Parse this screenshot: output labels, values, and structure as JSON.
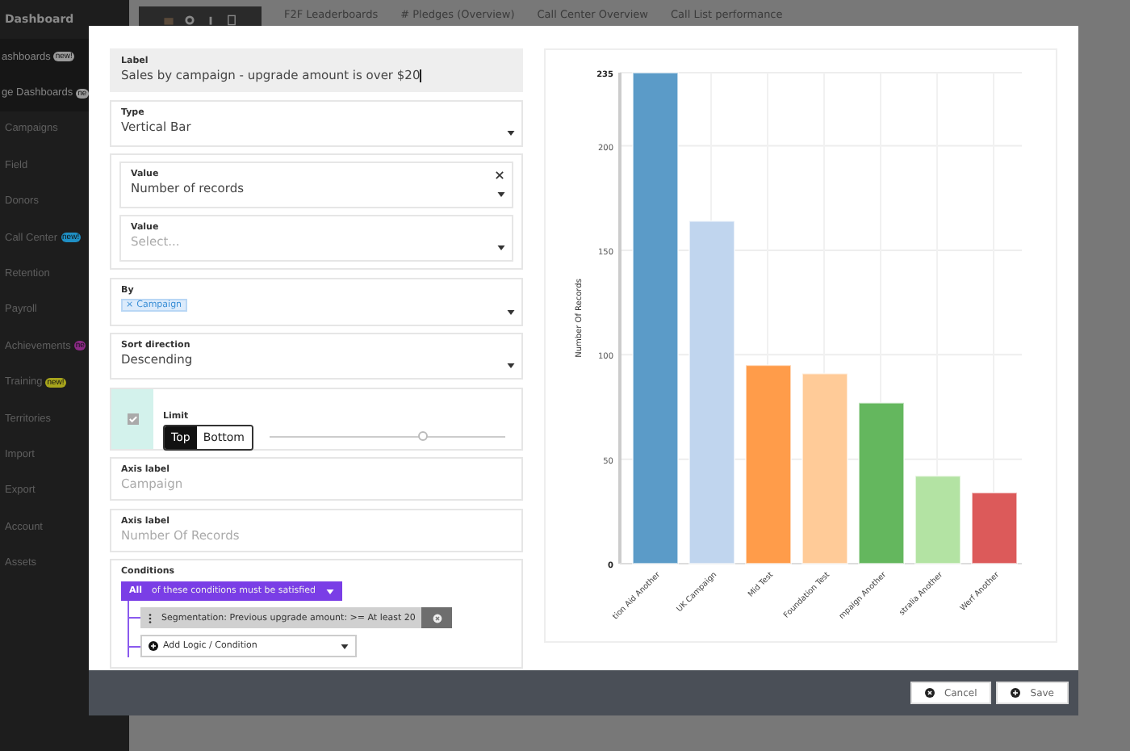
{
  "sidebar": {
    "header": "Dashboard",
    "items": [
      {
        "label": "ashboards",
        "badge": "new!",
        "color": "#9a9a9a",
        "group": true
      },
      {
        "label": "ge Dashboards",
        "badge": "ne",
        "color": "#9a9a9a",
        "group": true
      },
      {
        "label": "Campaigns",
        "group": false
      },
      {
        "label": "Field",
        "group": false
      },
      {
        "label": "Donors",
        "group": false
      },
      {
        "label": "Call Center",
        "badge": "new!",
        "color": "#1f8fc4",
        "group": false
      },
      {
        "label": "Retention",
        "group": false
      },
      {
        "label": "Payroll",
        "group": false
      },
      {
        "label": "Achievements",
        "badge": "ne",
        "color": "#8b2a86",
        "group": false
      },
      {
        "label": "Training",
        "badge": "new!",
        "color": "#a8a51c",
        "group": false
      },
      {
        "label": "Territories",
        "group": false
      },
      {
        "label": "Import",
        "group": false
      },
      {
        "label": "Export",
        "group": false
      },
      {
        "label": "Account",
        "group": false
      },
      {
        "label": "Assets",
        "group": false
      }
    ]
  },
  "tabs": [
    "F2F Leaderboards",
    "# Pledges (Overview)",
    "Call Center Overview",
    "Call List performance"
  ],
  "form": [
    {
      "kind": "input",
      "label": "Label",
      "value": "Sales by campaign - upgrade amount is over $20",
      "focused": true
    },
    {
      "kind": "select",
      "label": "Type",
      "value": "Vertical Bar"
    },
    {
      "kind": "group",
      "items": [
        {
          "label": "Value",
          "value": "Number of records",
          "removable": true
        },
        {
          "label": "Value",
          "placeholder": "Select...",
          "removable": false
        }
      ]
    },
    {
      "kind": "tags",
      "label": "By",
      "tags": [
        {
          "remove": "×",
          "label": "Campaign"
        }
      ]
    },
    {
      "kind": "select",
      "label": "Sort direction",
      "value": "Descending"
    },
    {
      "kind": "limit",
      "label": "Limit",
      "checked": true,
      "options": [
        {
          "label": "Top",
          "selected": true
        },
        {
          "label": "Bottom",
          "selected": false
        }
      ],
      "level": 0.65
    },
    {
      "kind": "input",
      "label": "Axis label",
      "placeholder": "Campaign",
      "focused": false
    },
    {
      "kind": "input",
      "label": "Axis label",
      "placeholder": "Number Of Records",
      "focused": false
    },
    {
      "kind": "conditions",
      "label": "Conditions",
      "match": "**All** of these conditions must be satisfied",
      "items": [
        "Segmentation: Previous upgrade amount: >= At least 20"
      ],
      "add": "Add Logic / Condition"
    }
  ],
  "chart_data": {
    "type": "bar",
    "ylabel": "Number Of Records",
    "categories": [
      "tion Aid Another",
      "UK Campaign",
      "Mid Test",
      "Foundation Test",
      "mpaign Another",
      "stralia Another",
      "Werf Another"
    ],
    "series": [
      {
        "values": [
          235,
          164,
          95,
          91,
          77,
          42,
          34
        ]
      }
    ],
    "grid": true,
    "colors": [
      "#5b9bc8",
      "#c0d5ee",
      "#ff9c4a",
      "#ffcb98",
      "#64b75e",
      "#b3e3a3",
      "#dc5a5a"
    ],
    "ylim": [
      0,
      235
    ],
    "yticks": [
      0,
      50,
      100,
      150,
      200,
      235
    ]
  },
  "buttons": [
    {
      "kind": "cancel",
      "label": "Cancel"
    },
    {
      "kind": "save",
      "label": "Save"
    }
  ]
}
